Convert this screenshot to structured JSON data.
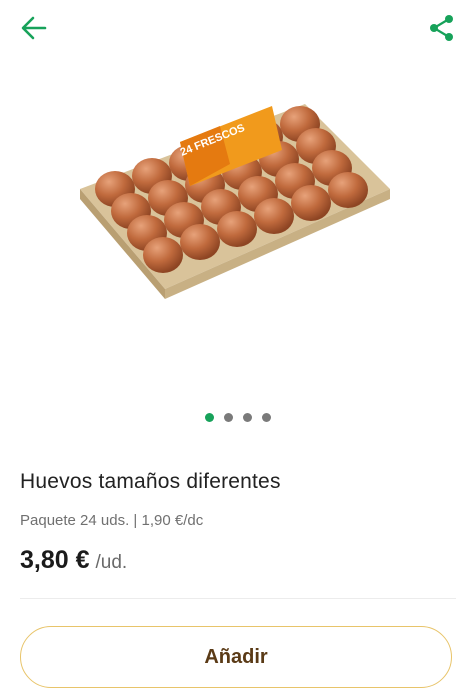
{
  "colors": {
    "accent": "#17a25a",
    "button_border": "#e8c46a",
    "button_text": "#5a3a16"
  },
  "header": {
    "back_icon": "arrow-left",
    "share_icon": "share"
  },
  "product": {
    "image_alt": "egg carton",
    "package_label": "24 FRESCOS",
    "name": "Huevos tamaños diferentes",
    "meta": "Paquete 24 uds. | 1,90 €/dc",
    "price": "3,80 €",
    "unit": "/ud."
  },
  "carousel": {
    "total": 4,
    "active": 0
  },
  "actions": {
    "add_label": "Añadir"
  }
}
